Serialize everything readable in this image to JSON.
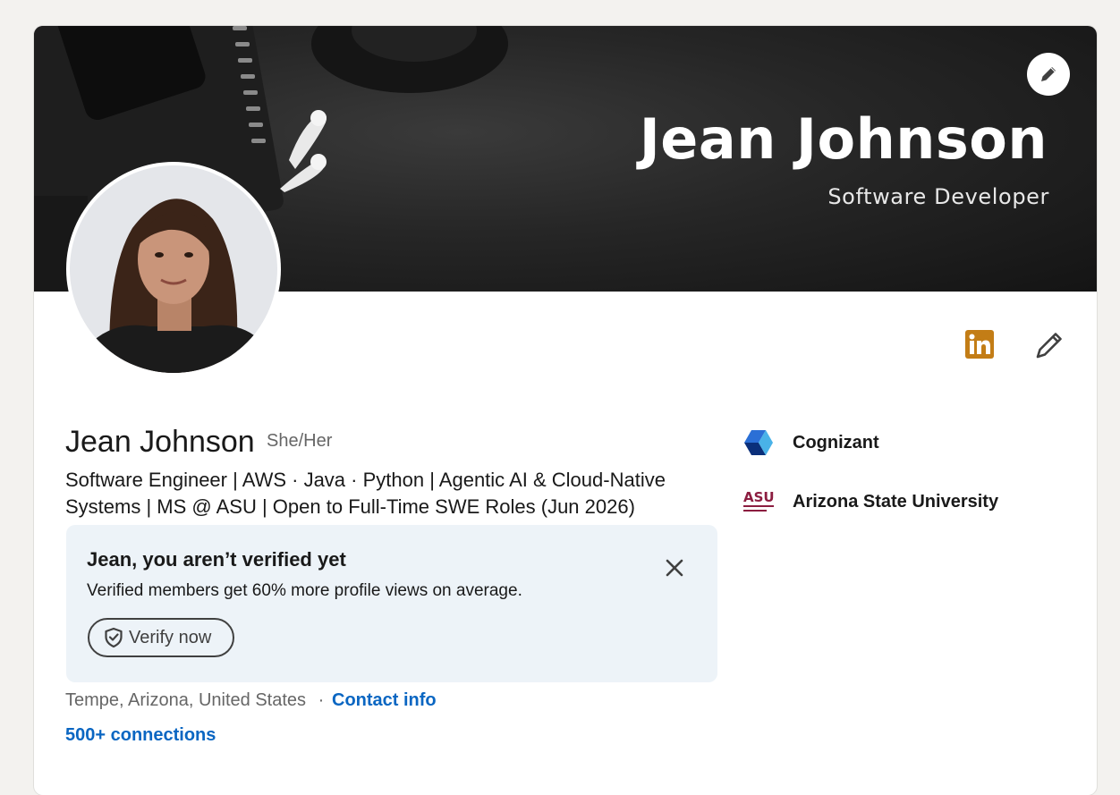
{
  "banner": {
    "title": "Jean Johnson",
    "subtitle": "Software Developer"
  },
  "profile": {
    "name": "Jean Johnson",
    "pronouns": "She/Her",
    "headline": "Software Engineer | AWS · Java · Python | Agentic AI & Cloud-Native Systems | MS @ ASU | Open to Full-Time SWE Roles (Jun 2026)",
    "location": "Tempe, Arizona, United States",
    "separator": "·",
    "contact_label": "Contact info",
    "connections_label": "500+ connections"
  },
  "verification": {
    "title": "Jean, you aren’t verified yet",
    "description": "Verified members get 60% more profile views on average.",
    "button_label": "Verify now"
  },
  "organizations": [
    {
      "name": "Cognizant",
      "logo": "cognizant-logo"
    },
    {
      "name": "Arizona State University",
      "logo": "asu-logo",
      "logo_text": "ASU"
    }
  ],
  "colors": {
    "link": "#0a66c2",
    "linkedin_badge": "#c37d16",
    "verify_bg": "#edf3f8",
    "page_bg": "#f3f2ef"
  },
  "icons": [
    "pencil-icon",
    "linkedin-icon",
    "close-icon",
    "shield-check-icon"
  ]
}
